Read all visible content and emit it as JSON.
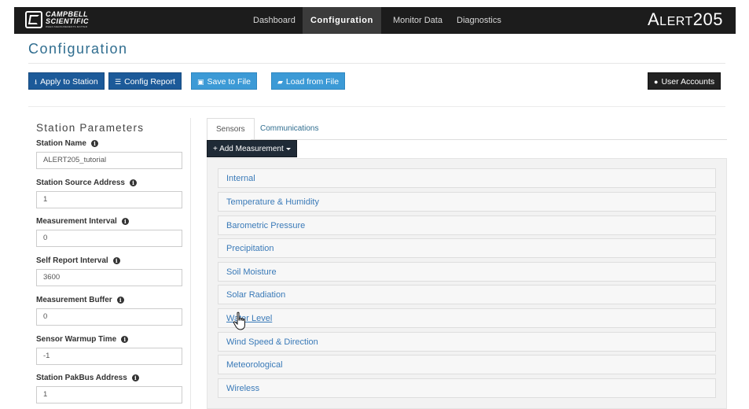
{
  "navbar": {
    "logo_line1": "CAMPBELL",
    "logo_line2": "SCIENTIFIC",
    "logo_line3": "WHEN MEASUREMENTS MATTER",
    "links": [
      "Dashboard",
      "Configuration",
      "Monitor Data",
      "Diagnostics"
    ],
    "active_link": "Configuration",
    "brand_a": "A",
    "brand_lert": "LERT",
    "brand_num": "205"
  },
  "page": {
    "title": "Configuration"
  },
  "toolbar": {
    "apply_label": "Apply to Station",
    "report_label": "Config Report",
    "save_label": "Save to File",
    "load_label": "Load from File",
    "accounts_label": "User Accounts"
  },
  "params": {
    "title": "Station Parameters",
    "fields": [
      {
        "label": "Station Name",
        "value": "ALERT205_tutorial"
      },
      {
        "label": "Station Source Address",
        "value": "1"
      },
      {
        "label": "Measurement Interval",
        "value": "0"
      },
      {
        "label": "Self Report Interval",
        "value": "3600"
      },
      {
        "label": "Measurement Buffer",
        "value": "0"
      },
      {
        "label": "Sensor Warmup Time",
        "value": "-1"
      },
      {
        "label": "Station PakBus Address",
        "value": "1"
      }
    ]
  },
  "tabs": [
    "Sensors",
    "Communications"
  ],
  "active_tab": "Sensors",
  "add_measurement_label": "+ Add Measurement",
  "measurements": [
    "Internal",
    "Temperature & Humidity",
    "Barometric Pressure",
    "Precipitation",
    "Soil Moisture",
    "Solar Radiation",
    "Water Level",
    "Wind Speed & Direction",
    "Meteorological",
    "Wireless"
  ],
  "colors": {
    "navbar_bg": "#1c1c1c",
    "title_blue": "#2f6d8f",
    "btn_dark_blue": "#1c5a99",
    "btn_light_blue": "#3c9ad6",
    "link_blue": "#3a7ab8"
  },
  "icons": {
    "apply": "download-icon",
    "report": "list-icon",
    "save": "save-icon",
    "load": "folder-open-icon",
    "accounts": "user-icon",
    "info": "info-circle-icon"
  }
}
